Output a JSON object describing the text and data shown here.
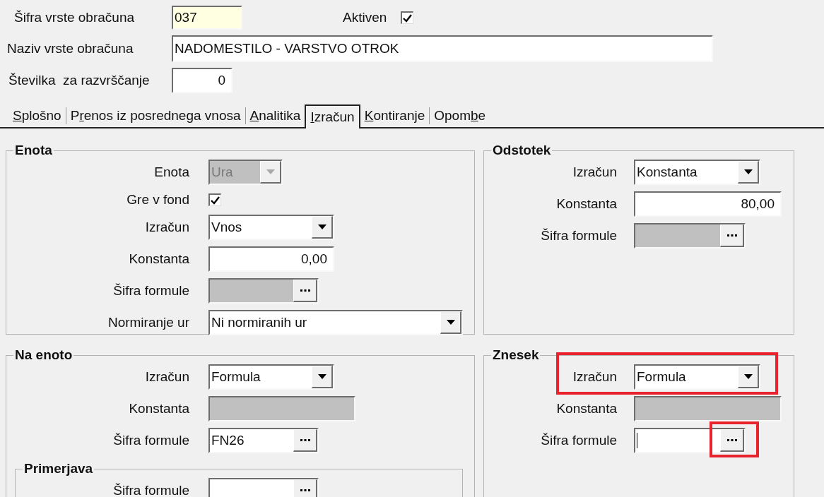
{
  "header": {
    "code": {
      "label": "Šifra vrste obračuna",
      "value": "037"
    },
    "active": {
      "label": "Aktiven",
      "checked": true
    },
    "name": {
      "label": "Naziv vrste obračuna",
      "value": "NADOMESTILO - VARSTVO OTROK"
    },
    "sort": {
      "label": "Številka  za razvrščanje",
      "value": "0"
    }
  },
  "tabs": [
    {
      "key": "S",
      "after": "plošno",
      "selected": false
    },
    {
      "before": "P",
      "key": "r",
      "after": "enos iz posrednega vnosa",
      "selected": false
    },
    {
      "key": "A",
      "after": "nalitika",
      "selected": false
    },
    {
      "key": "I",
      "after": "zračun",
      "selected": true
    },
    {
      "key": "K",
      "after": "ontiranje",
      "selected": false
    },
    {
      "before": "Opom",
      "key": "b",
      "after": "e",
      "selected": false
    }
  ],
  "sections": [
    {
      "title": "Enota",
      "rows": [
        {
          "kind": "combo",
          "label": "Enota",
          "value": "Ura",
          "disabled": true
        },
        {
          "kind": "checkbox",
          "label": "Gre v fond",
          "checked": true
        },
        {
          "kind": "combo",
          "label": "Izračun",
          "value": "Vnos",
          "disabled": false
        },
        {
          "kind": "number",
          "label": "Konstanta",
          "value": "0,00",
          "disabled": false
        },
        {
          "kind": "lookup",
          "label": "Šifra formule",
          "disabled": true
        },
        {
          "kind": "combo",
          "label": "Normiranje ur",
          "value": "Ni normiranih ur",
          "disabled": false
        }
      ]
    },
    {
      "title": "Odstotek",
      "rows": [
        {
          "kind": "combo",
          "label": "Izračun",
          "value": "Konstanta",
          "disabled": false
        },
        {
          "kind": "number",
          "label": "Konstanta",
          "value": "80,00",
          "disabled": false
        },
        {
          "kind": "lookup",
          "label": "Šifra formule",
          "disabled": true
        }
      ]
    },
    {
      "title": "Na enoto",
      "rows": [
        {
          "kind": "combo",
          "label": "Izračun",
          "value": "Formula",
          "disabled": false
        },
        {
          "kind": "number",
          "label": "Konstanta",
          "disabled": true
        },
        {
          "kind": "lookup",
          "label": "Šifra formule",
          "value": "FN26",
          "disabled": false
        }
      ],
      "groups": [
        {
          "title": "Primerjava",
          "rows": [
            {
              "kind": "lookup",
              "label": "Šifra formule",
              "disabled": false
            }
          ]
        }
      ]
    },
    {
      "title": "Znesek",
      "rows": [
        {
          "kind": "combo",
          "label": "Izračun",
          "value": "Formula",
          "disabled": false,
          "highlighted": true
        },
        {
          "kind": "number",
          "label": "Konstanta",
          "disabled": true
        },
        {
          "kind": "lookup",
          "label": "Šifra formule",
          "disabled": false,
          "focused": true,
          "button_highlighted": true
        }
      ]
    }
  ]
}
